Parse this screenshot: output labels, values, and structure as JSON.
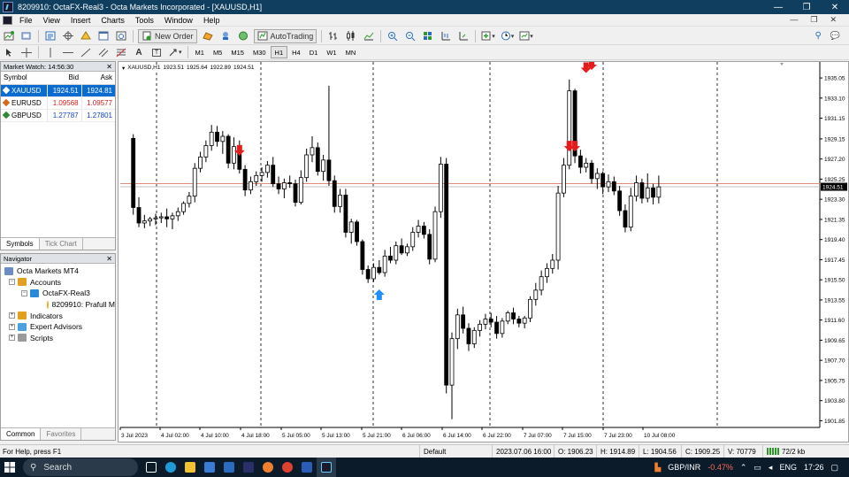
{
  "window": {
    "title": "8209910: OctaFX-Real3 - Octa Markets Incorporated - [XAUUSD,H1]",
    "controls": [
      "—",
      "❐",
      "✕"
    ]
  },
  "menu": [
    "File",
    "View",
    "Insert",
    "Charts",
    "Tools",
    "Window",
    "Help"
  ],
  "toolbar": {
    "new_order": "New Order",
    "autotrading": "AutoTrading",
    "timeframes": [
      "M1",
      "M5",
      "M15",
      "M30",
      "H1",
      "H4",
      "D1",
      "W1",
      "MN"
    ],
    "active_timeframe": "H1"
  },
  "market_watch": {
    "header": "Market Watch: 14:56:30",
    "columns": [
      "Symbol",
      "Bid",
      "Ask"
    ],
    "rows": [
      {
        "symbol": "XAUUSD",
        "bid": "1924.51",
        "ask": "1924.81",
        "selected": true,
        "color": "#2e8b2e"
      },
      {
        "symbol": "EURUSD",
        "bid": "1.09568",
        "ask": "1.09577",
        "selected": false,
        "color": "#d2691e"
      },
      {
        "symbol": "GBPUSD",
        "bid": "1.27787",
        "ask": "1.27801",
        "selected": false,
        "color": "#2e8b2e"
      }
    ],
    "tabs": [
      "Symbols",
      "Tick Chart"
    ]
  },
  "navigator": {
    "header": "Navigator",
    "items": [
      {
        "label": "Octa Markets MT4",
        "level": 0,
        "icon": "terminal-icon"
      },
      {
        "label": "Accounts",
        "level": 1,
        "icon": "accounts-icon",
        "exp": "−"
      },
      {
        "label": "OctaFX-Real3",
        "level": 2,
        "icon": "server-icon",
        "exp": "−"
      },
      {
        "label": "8209910: Prafull M",
        "level": 3,
        "icon": "account-icon"
      },
      {
        "label": "Indicators",
        "level": 1,
        "icon": "indicators-icon",
        "exp": "+"
      },
      {
        "label": "Expert Advisors",
        "level": 1,
        "icon": "expert-advisors-icon",
        "exp": "+"
      },
      {
        "label": "Scripts",
        "level": 1,
        "icon": "scripts-icon",
        "exp": "+"
      }
    ],
    "tabs": [
      "Common",
      "Favorites"
    ]
  },
  "chart_header": {
    "symbol": "XAUUSD,H1",
    "ohlc": [
      "1923.51",
      "1925.64",
      "1922.89",
      "1924.51"
    ]
  },
  "chart_data": {
    "type": "candlestick",
    "symbol": "XAUUSD",
    "timeframe": "H1",
    "ylim": [
      1901.2,
      1936.6
    ],
    "y_ticks": [
      "1935.05",
      "1933.10",
      "1931.15",
      "1929.15",
      "1927.20",
      "1925.25",
      "1923.30",
      "1921.35",
      "1919.40",
      "1917.45",
      "1915.50",
      "1913.55",
      "1911.60",
      "1909.65",
      "1907.70",
      "1905.75",
      "1903.80",
      "1901.85"
    ],
    "bid_price": "1924.51",
    "ask_line": 1924.81,
    "x_ticks": [
      "3 Jul 2023",
      "4 Jul 02:00",
      "4 Jul 10:00",
      "4 Jul 18:00",
      "5 Jul 05:00",
      "5 Jul 13:00",
      "5 Jul 21:00",
      "6 Jul 06:00",
      "6 Jul 14:00",
      "6 Jul 22:00",
      "7 Jul 07:00",
      "7 Jul 15:00",
      "7 Jul 23:00",
      "10 Jul 08:00"
    ],
    "candles": [
      [
        1929.2,
        1929.6,
        1921.8,
        1922.5
      ],
      [
        1922.5,
        1923.5,
        1920.6,
        1921.0
      ],
      [
        1921.0,
        1921.8,
        1920.5,
        1921.2
      ],
      [
        1921.2,
        1921.6,
        1920.7,
        1921.4
      ],
      [
        1921.4,
        1921.9,
        1920.8,
        1921.5
      ],
      [
        1921.5,
        1922.0,
        1921.0,
        1921.6
      ],
      [
        1921.6,
        1922.4,
        1920.6,
        1921.4
      ],
      [
        1921.4,
        1922.0,
        1920.4,
        1921.7
      ],
      [
        1921.7,
        1922.5,
        1921.2,
        1922.1
      ],
      [
        1922.1,
        1923.1,
        1921.8,
        1922.9
      ],
      [
        1922.9,
        1924.0,
        1922.5,
        1923.6
      ],
      [
        1923.6,
        1926.8,
        1923.0,
        1926.3
      ],
      [
        1926.3,
        1927.9,
        1925.9,
        1927.4
      ],
      [
        1927.4,
        1929.0,
        1926.9,
        1928.5
      ],
      [
        1928.5,
        1930.5,
        1928.0,
        1929.8
      ],
      [
        1929.8,
        1930.4,
        1928.4,
        1928.9
      ],
      [
        1928.9,
        1929.9,
        1927.7,
        1929.4
      ],
      [
        1929.4,
        1929.6,
        1926.3,
        1926.8
      ],
      [
        1926.8,
        1929.3,
        1926.2,
        1928.4
      ],
      [
        1928.4,
        1929.0,
        1925.8,
        1926.2
      ],
      [
        1926.2,
        1926.6,
        1923.6,
        1924.2
      ],
      [
        1924.2,
        1925.5,
        1923.8,
        1925.0
      ],
      [
        1925.0,
        1926.0,
        1924.6,
        1925.6
      ],
      [
        1925.6,
        1926.4,
        1925.0,
        1925.9
      ],
      [
        1925.9,
        1927.0,
        1925.4,
        1926.6
      ],
      [
        1926.6,
        1927.4,
        1924.5,
        1924.8
      ],
      [
        1924.8,
        1925.5,
        1923.8,
        1924.3
      ],
      [
        1924.3,
        1925.3,
        1923.4,
        1924.9
      ],
      [
        1924.9,
        1925.6,
        1924.4,
        1924.8
      ],
      [
        1924.8,
        1925.2,
        1922.6,
        1923.0
      ],
      [
        1923.0,
        1926.1,
        1922.8,
        1925.4
      ],
      [
        1925.4,
        1928.2,
        1925.0,
        1927.6
      ],
      [
        1927.6,
        1929.4,
        1926.9,
        1928.3
      ],
      [
        1928.3,
        1928.8,
        1925.6,
        1926.0
      ],
      [
        1926.0,
        1927.6,
        1925.1,
        1927.1
      ],
      [
        1927.1,
        1934.3,
        1924.6,
        1925.1
      ],
      [
        1925.1,
        1925.6,
        1922.0,
        1922.6
      ],
      [
        1922.6,
        1924.3,
        1922.0,
        1923.7
      ],
      [
        1923.7,
        1924.3,
        1919.6,
        1920.1
      ],
      [
        1920.1,
        1921.4,
        1919.0,
        1921.1
      ],
      [
        1921.1,
        1921.3,
        1918.8,
        1919.2
      ],
      [
        1919.2,
        1919.4,
        1916.0,
        1916.5
      ],
      [
        1916.5,
        1916.9,
        1915.2,
        1915.6
      ],
      [
        1915.6,
        1917.1,
        1915.3,
        1916.7
      ],
      [
        1916.7,
        1917.4,
        1916.0,
        1916.2
      ],
      [
        1916.2,
        1918.4,
        1915.8,
        1917.8
      ],
      [
        1917.8,
        1918.7,
        1917.1,
        1917.4
      ],
      [
        1917.4,
        1919.2,
        1917.0,
        1918.8
      ],
      [
        1918.8,
        1919.5,
        1917.9,
        1918.1
      ],
      [
        1918.1,
        1919.0,
        1917.8,
        1918.7
      ],
      [
        1918.7,
        1920.6,
        1918.3,
        1920.1
      ],
      [
        1920.1,
        1921.3,
        1919.6,
        1920.7
      ],
      [
        1920.7,
        1921.1,
        1919.5,
        1919.9
      ],
      [
        1919.9,
        1920.4,
        1917.0,
        1917.5
      ],
      [
        1917.5,
        1922.6,
        1917.2,
        1922.1
      ],
      [
        1922.1,
        1927.4,
        1921.5,
        1926.7
      ],
      [
        1926.7,
        1927.3,
        1904.5,
        1905.3
      ],
      [
        1905.3,
        1910.4,
        1902.0,
        1909.8
      ],
      [
        1909.8,
        1912.7,
        1908.8,
        1912.1
      ],
      [
        1912.1,
        1912.9,
        1910.3,
        1910.8
      ],
      [
        1910.8,
        1911.3,
        1908.6,
        1909.3
      ],
      [
        1909.3,
        1910.9,
        1908.9,
        1910.6
      ],
      [
        1910.6,
        1911.6,
        1910.0,
        1911.2
      ],
      [
        1911.2,
        1912.2,
        1910.7,
        1911.7
      ],
      [
        1911.7,
        1912.3,
        1910.9,
        1911.4
      ],
      [
        1911.4,
        1912.0,
        1909.8,
        1910.3
      ],
      [
        1910.3,
        1911.8,
        1909.9,
        1911.5
      ],
      [
        1911.5,
        1912.5,
        1911.2,
        1912.3
      ],
      [
        1912.3,
        1912.8,
        1911.2,
        1911.7
      ],
      [
        1911.7,
        1912.0,
        1910.9,
        1911.3
      ],
      [
        1911.3,
        1912.0,
        1910.8,
        1911.8
      ],
      [
        1911.8,
        1913.9,
        1911.4,
        1913.6
      ],
      [
        1913.6,
        1915.2,
        1913.0,
        1914.5
      ],
      [
        1914.5,
        1916.4,
        1914.0,
        1915.8
      ],
      [
        1915.8,
        1917.1,
        1915.2,
        1916.6
      ],
      [
        1916.6,
        1918.0,
        1916.1,
        1917.4
      ],
      [
        1917.4,
        1924.6,
        1916.5,
        1923.9
      ],
      [
        1923.9,
        1927.3,
        1923.5,
        1926.6
      ],
      [
        1926.6,
        1934.9,
        1926.2,
        1933.8
      ],
      [
        1933.8,
        1934.0,
        1926.8,
        1927.5
      ],
      [
        1927.5,
        1928.1,
        1925.8,
        1926.4
      ],
      [
        1926.4,
        1927.3,
        1925.9,
        1926.8
      ],
      [
        1926.8,
        1927.1,
        1924.8,
        1925.3
      ],
      [
        1925.3,
        1926.3,
        1924.3,
        1925.8
      ],
      [
        1925.8,
        1926.0,
        1923.8,
        1924.5
      ],
      [
        1924.5,
        1925.7,
        1924.0,
        1925.0
      ],
      [
        1925.0,
        1925.5,
        1923.7,
        1924.1
      ],
      [
        1924.1,
        1924.6,
        1921.7,
        1922.2
      ],
      [
        1922.2,
        1922.8,
        1920.1,
        1920.6
      ],
      [
        1920.6,
        1924.4,
        1920.2,
        1923.6
      ],
      [
        1923.6,
        1925.6,
        1923.1,
        1924.9
      ],
      [
        1924.9,
        1925.3,
        1922.9,
        1923.4
      ],
      [
        1923.4,
        1925.8,
        1923.0,
        1924.4
      ],
      [
        1924.4,
        1924.8,
        1922.8,
        1923.5
      ],
      [
        1923.5,
        1925.6,
        1922.9,
        1924.5
      ]
    ],
    "sell_arrows": [
      [
        19,
        1927.7
      ],
      [
        78,
        1928.1
      ],
      [
        79,
        1928.1
      ],
      [
        81,
        1935.7
      ],
      [
        82,
        1936.0
      ]
    ],
    "buy_arrows": [
      [
        44,
        1914.4
      ]
    ]
  },
  "status": {
    "help": "For Help, press F1",
    "profile": "Default",
    "datetime": "2023.07.06 16:00",
    "open": "O: 1906.23",
    "high": "H: 1914.89",
    "low": "L: 1904.56",
    "close": "C: 1909.25",
    "volume": "V: 70779",
    "traffic": "72/2 kb"
  },
  "taskbar": {
    "search": "Search",
    "currency": "GBP/INR",
    "change": "-0.47%",
    "lang": "ENG",
    "time": "17:26"
  },
  "colors": {
    "titlebar": "#0f3e5f",
    "selected_row": "#0a6bd0",
    "bid_line": "#e08a7a",
    "sell_arrow": "#e41c1c",
    "buy_arrow": "#1e90ff",
    "price_tag": "#000000"
  }
}
